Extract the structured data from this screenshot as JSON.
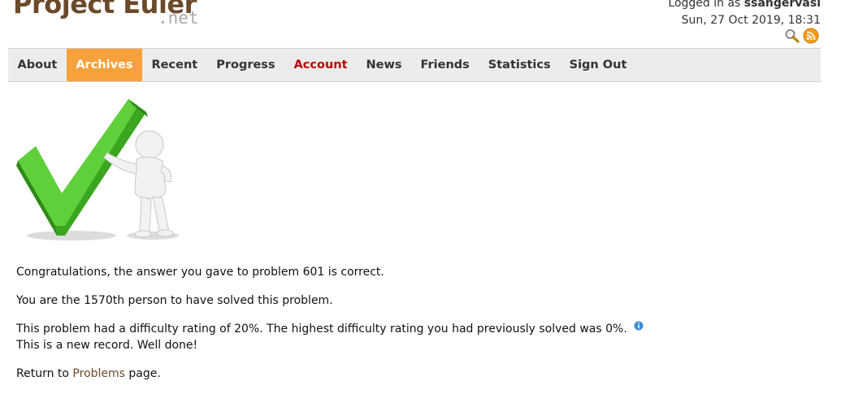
{
  "header": {
    "logo_main": "Project Euler",
    "logo_net": ".net",
    "logged_in_prefix": "Logged in as ",
    "username": "ssangervasi",
    "datetime": "Sun, 27 Oct 2019, 18:31",
    "icons": [
      "search-icon",
      "rss-icon"
    ]
  },
  "nav": {
    "items": [
      {
        "label": "About"
      },
      {
        "label": "Archives"
      },
      {
        "label": "Recent"
      },
      {
        "label": "Progress"
      },
      {
        "label": "Account"
      },
      {
        "label": "News"
      },
      {
        "label": "Friends"
      },
      {
        "label": "Statistics"
      },
      {
        "label": "Sign Out"
      }
    ],
    "active_color": "#f7a13d",
    "alert_color": "#c00000"
  },
  "content": {
    "congrats": "Congratulations, the answer you gave to problem 601 is correct.",
    "solver": "You are the 1570th person to have solved this problem.",
    "difficulty": "This problem had a difficulty rating of 20%. The highest difficulty rating you had previously solved was 0%.",
    "record": "This is a new record. Well done!",
    "return_prefix": "Return to ",
    "return_link": "Problems",
    "return_suffix": " page."
  },
  "colors": {
    "brand": "#6b4a2b",
    "accent": "#f7a13d",
    "check_green": "#4cbc2c"
  }
}
